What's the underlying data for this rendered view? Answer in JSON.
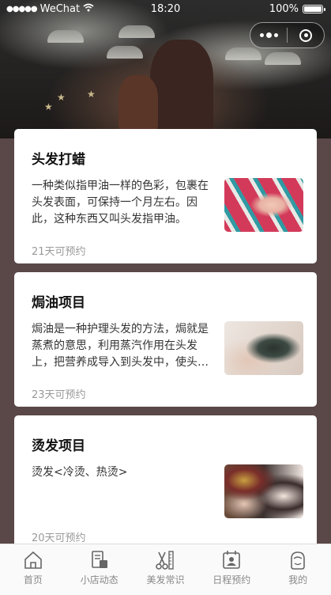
{
  "status_bar": {
    "carrier": "WeChat",
    "time": "18:20",
    "battery": "100%"
  },
  "capsule": {
    "more_icon": "more-dots-icon",
    "close_icon": "close-target-icon"
  },
  "services": [
    {
      "title": "头发打蜡",
      "description": "一种类似指甲油一样的色彩，包裹在头发表面，可保持一个月左右。因此，这种东西又叫头发指甲油。",
      "availability": "21天可预约",
      "thumb": "hair-wax-photo"
    },
    {
      "title": "焗油项目",
      "description": "焗油是一种护理头发的方法，焗就是蒸煮的意思，利用蒸汽作用在头发上，把营养成导入到头发中，使头发得到滋养。",
      "availability": "23天可预约",
      "thumb": "hair-oil-photo"
    },
    {
      "title": "烫发项目",
      "description": "烫发<冷烫、热烫>",
      "availability": "20天可预约",
      "thumb": "perm-photo"
    }
  ],
  "tabbar": {
    "items": [
      {
        "label": "首页",
        "icon": "home-icon"
      },
      {
        "label": "小店动态",
        "icon": "shop-news-icon"
      },
      {
        "label": "美发常识",
        "icon": "scissors-comb-icon"
      },
      {
        "label": "日程预约",
        "icon": "schedule-icon"
      },
      {
        "label": "我的",
        "icon": "profile-icon"
      }
    ]
  }
}
